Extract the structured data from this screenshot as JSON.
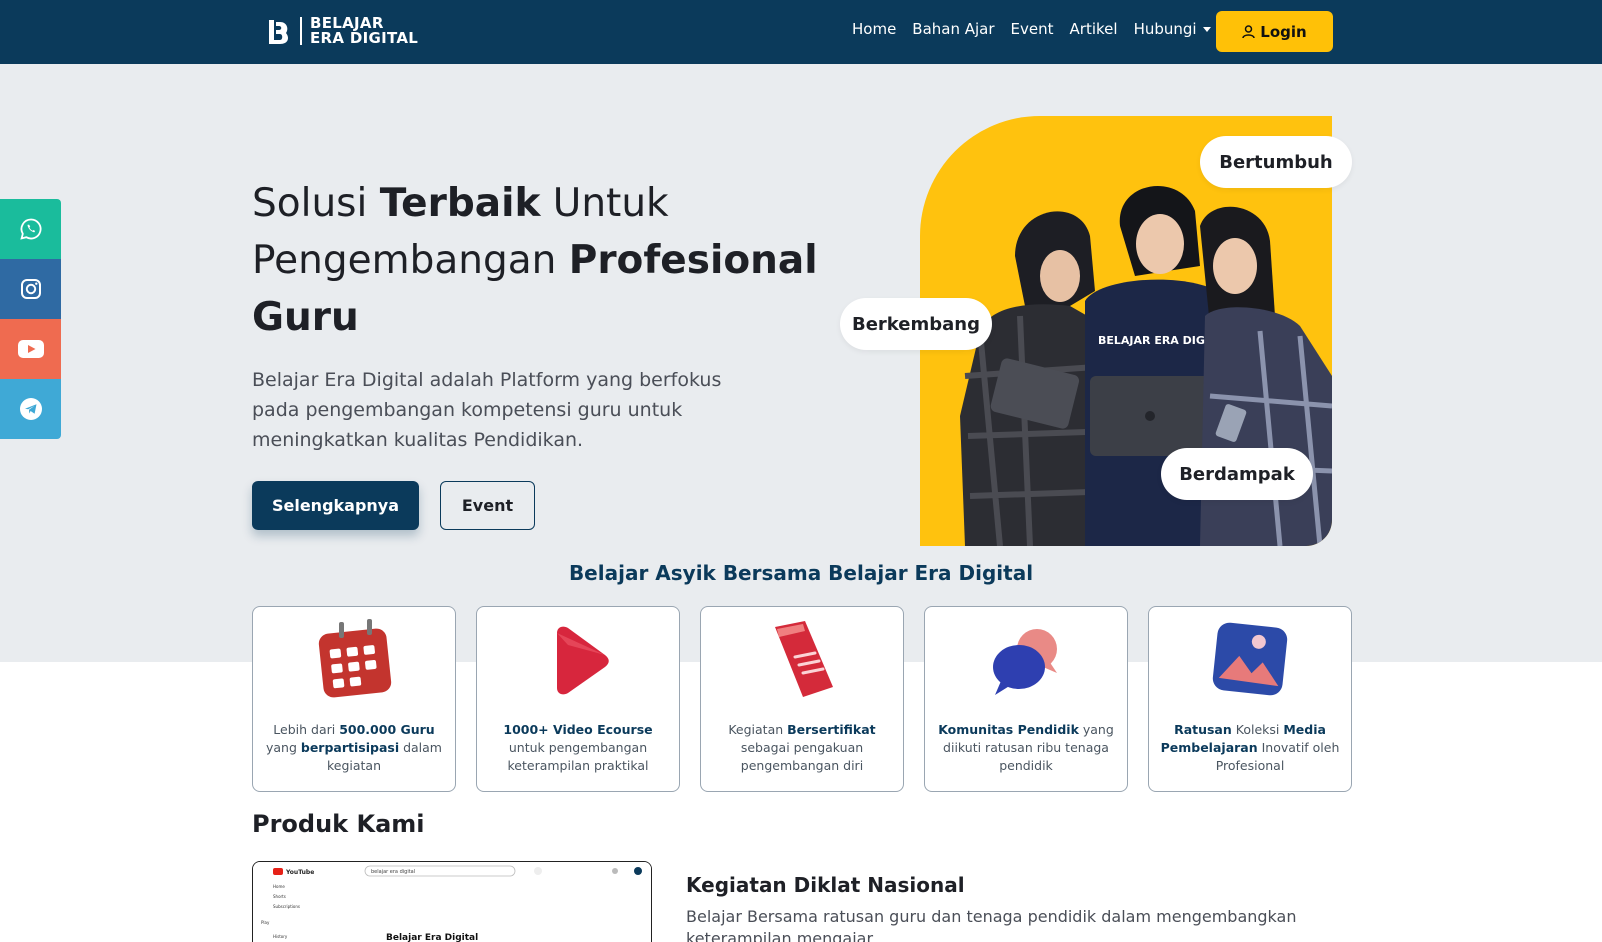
{
  "brand": {
    "line1": "BELAJAR",
    "line2": "ERA DIGITAL"
  },
  "nav": {
    "items": [
      "Home",
      "Bahan Ajar",
      "Event",
      "Artikel"
    ],
    "dropdown": "Hubungi",
    "login": "Login"
  },
  "social": [
    "whatsapp-icon",
    "instagram-icon",
    "youtube-icon",
    "telegram-icon"
  ],
  "hero": {
    "t1": "Solusi ",
    "t1b": "Terbaik",
    "t2": " Untuk",
    "t3": "Pengembangan ",
    "t3b": "Profesional",
    "t4b": "Guru",
    "desc": "Belajar Era Digital adalah Platform yang berfokus pada pengembangan kompetensi guru untuk meningkatkan kualitas Pendidikan.",
    "btn_primary": "Selengkapnya",
    "btn_secondary": "Event",
    "pills": [
      "Bertumbuh",
      "Berkembang",
      "Berdampak"
    ],
    "shirt_text": "BELAJAR ERA DIGITAL"
  },
  "section": {
    "title": "Belajar Asyik Bersama Belajar Era Digital"
  },
  "cards": [
    {
      "a": "Lebih dari ",
      "b": "500.000 Guru",
      "c": " yang ",
      "d": "berpartisipasi",
      "e": " dalam kegiatan"
    },
    {
      "a": "",
      "b": "1000+ Video Ecourse",
      "c": " untuk pengembangan keterampilan praktikal",
      "d": "",
      "e": ""
    },
    {
      "a": "Kegiatan ",
      "b": "Bersertifikat",
      "c": " sebagai pengakuan pengembangan diri",
      "d": "",
      "e": ""
    },
    {
      "a": "",
      "b": "Komunitas Pendidik",
      "c": " yang diikuti ratusan ribu tenaga pendidik",
      "d": "",
      "e": ""
    },
    {
      "a": "",
      "b": "Ratusan",
      "c": " Koleksi ",
      "d": "Media Pembelajaran",
      "e": " Inovatif oleh Profesional"
    }
  ],
  "produk": {
    "title": "Produk Kami",
    "head": "Kegiatan Diklat Nasional",
    "desc": "Belajar Bersama ratusan guru dan tenaga pendidik dalam mengembangkan keterampilan mengajar",
    "shot": {
      "search": "belajar era digital",
      "side": [
        "Home",
        "Shorts",
        "Subscriptions",
        "Play",
        "History"
      ],
      "caption": "Belajar Era Digital",
      "logo": "YouTube"
    }
  },
  "colors": {
    "navy": "#0b3a5b",
    "yellow": "#ffc107",
    "hero_bg": "#e9ecef"
  }
}
